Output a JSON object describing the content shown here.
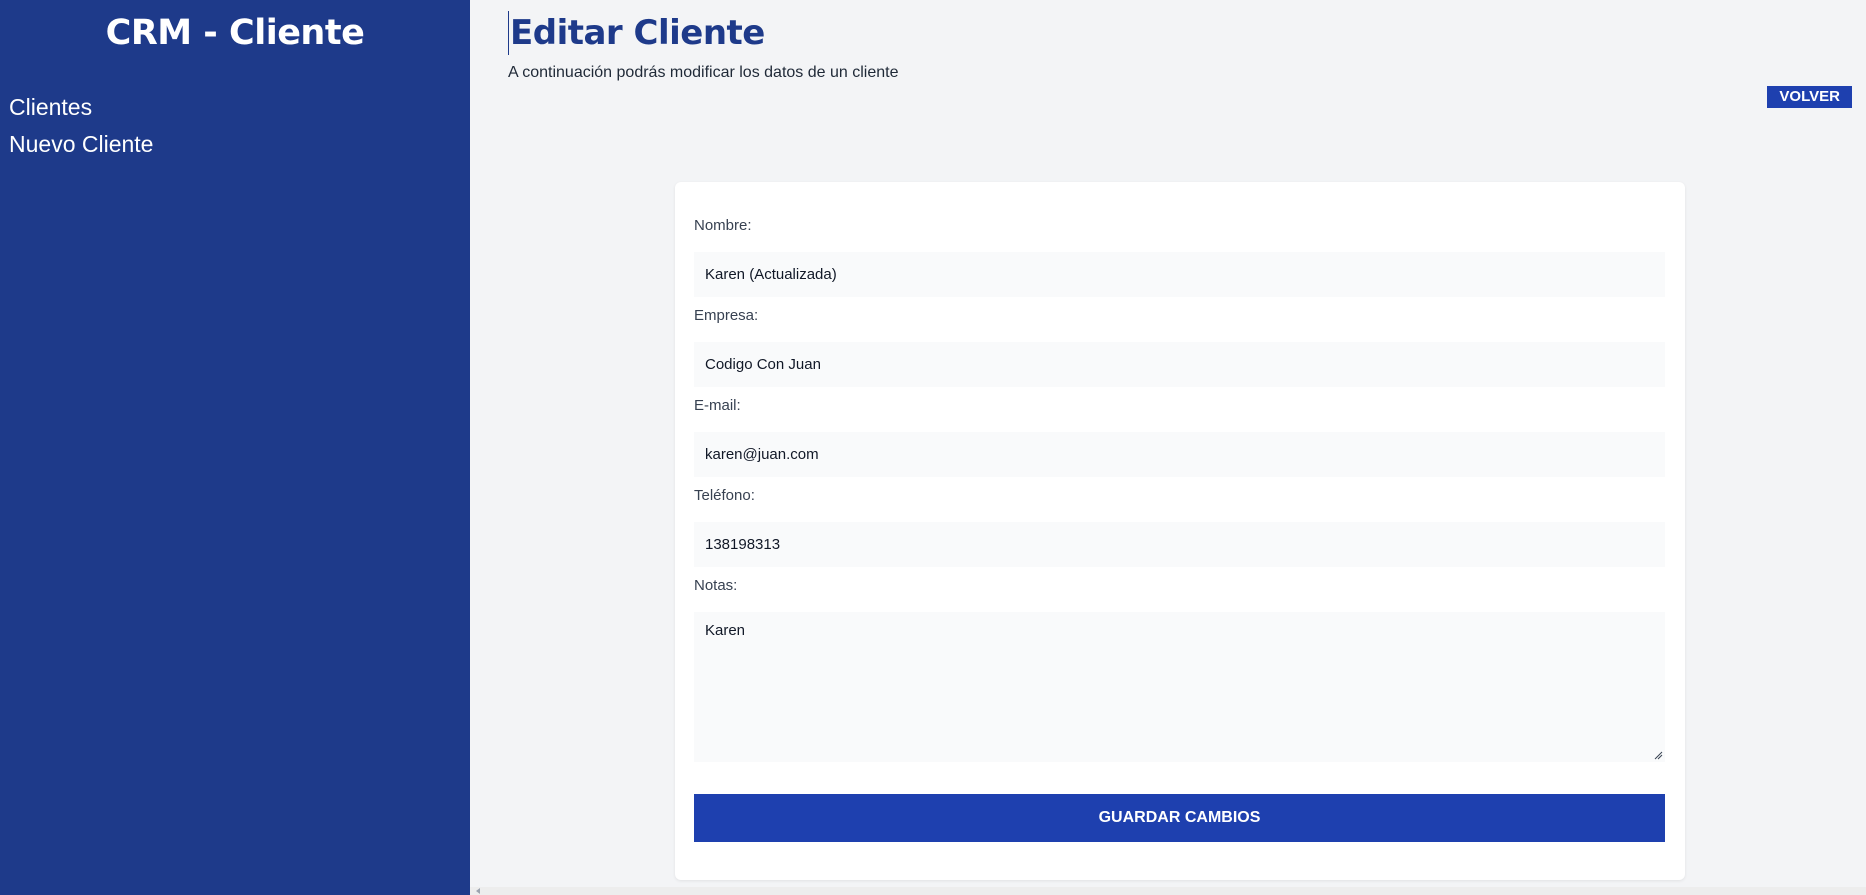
{
  "sidebar": {
    "brand": "CRM - Cliente",
    "items": [
      {
        "label": "Clientes"
      },
      {
        "label": "Nuevo Cliente"
      }
    ]
  },
  "header": {
    "title": "Editar Cliente",
    "subtitle": "A continuación podrás modificar los datos de un cliente",
    "back_label": "VOLVER"
  },
  "form": {
    "nombre": {
      "label": "Nombre:",
      "value": "Karen (Actualizada)"
    },
    "empresa": {
      "label": "Empresa:",
      "value": "Codigo Con Juan"
    },
    "email": {
      "label": "E-mail:",
      "value": "karen@juan.com"
    },
    "telefono": {
      "label": "Teléfono:",
      "value": "138198313"
    },
    "notas": {
      "label": "Notas:",
      "value": "Karen"
    },
    "submit_label": "GUARDAR CAMBIOS"
  },
  "colors": {
    "sidebar_bg": "#1e3a8a",
    "accent": "#1e40af",
    "page_bg": "#f3f4f6"
  }
}
